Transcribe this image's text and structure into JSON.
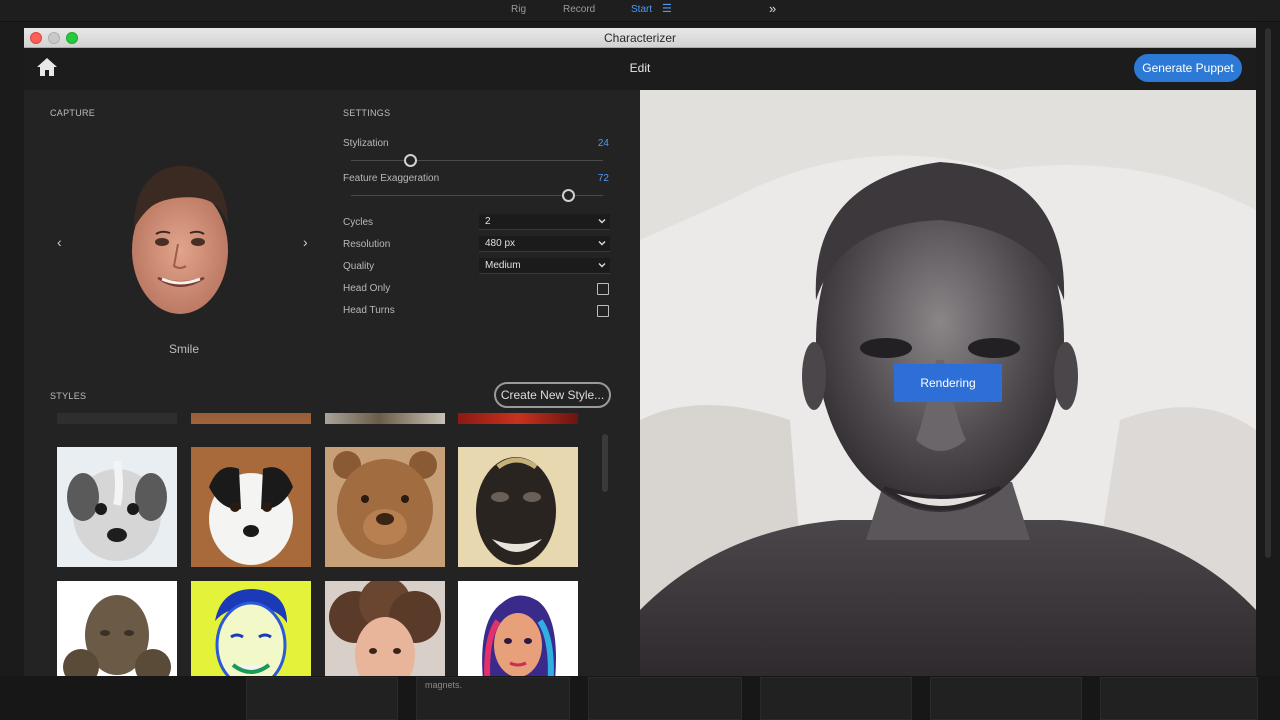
{
  "host": {
    "tabs": [
      {
        "label": "Rig"
      },
      {
        "label": "Record"
      },
      {
        "label": "Start"
      }
    ],
    "note": "magnets."
  },
  "window": {
    "title": "Characterizer",
    "header_title": "Edit",
    "generate_label": "Generate Puppet"
  },
  "capture": {
    "section_label": "CAPTURE",
    "expression_label": "Smile",
    "prev_icon": "‹",
    "next_icon": "›"
  },
  "settings": {
    "section_label": "SETTINGS",
    "stylization": {
      "label": "Stylization",
      "value": "24"
    },
    "exaggeration": {
      "label": "Feature Exaggeration",
      "value": "72"
    },
    "cycles": {
      "label": "Cycles",
      "value": "2"
    },
    "resolution": {
      "label": "Resolution",
      "value": "480 px"
    },
    "quality": {
      "label": "Quality",
      "value": "Medium"
    },
    "head_only": {
      "label": "Head Only",
      "checked": false
    },
    "head_turns": {
      "label": "Head Turns",
      "checked": false
    }
  },
  "styles": {
    "section_label": "STYLES",
    "create_label": "Create New Style...",
    "tiles": [
      {
        "name": "puppy"
      },
      {
        "name": "border-collie"
      },
      {
        "name": "wooden-bear"
      },
      {
        "name": "carved-mask"
      },
      {
        "name": "bronze-bust"
      },
      {
        "name": "pop-art-portrait"
      },
      {
        "name": "curly-hair-painting"
      },
      {
        "name": "rainbow-watercolor"
      }
    ]
  },
  "preview": {
    "rendering_label": "Rendering"
  },
  "colors": {
    "accent": "#2d7ad6",
    "value_blue": "#4c9af2"
  }
}
